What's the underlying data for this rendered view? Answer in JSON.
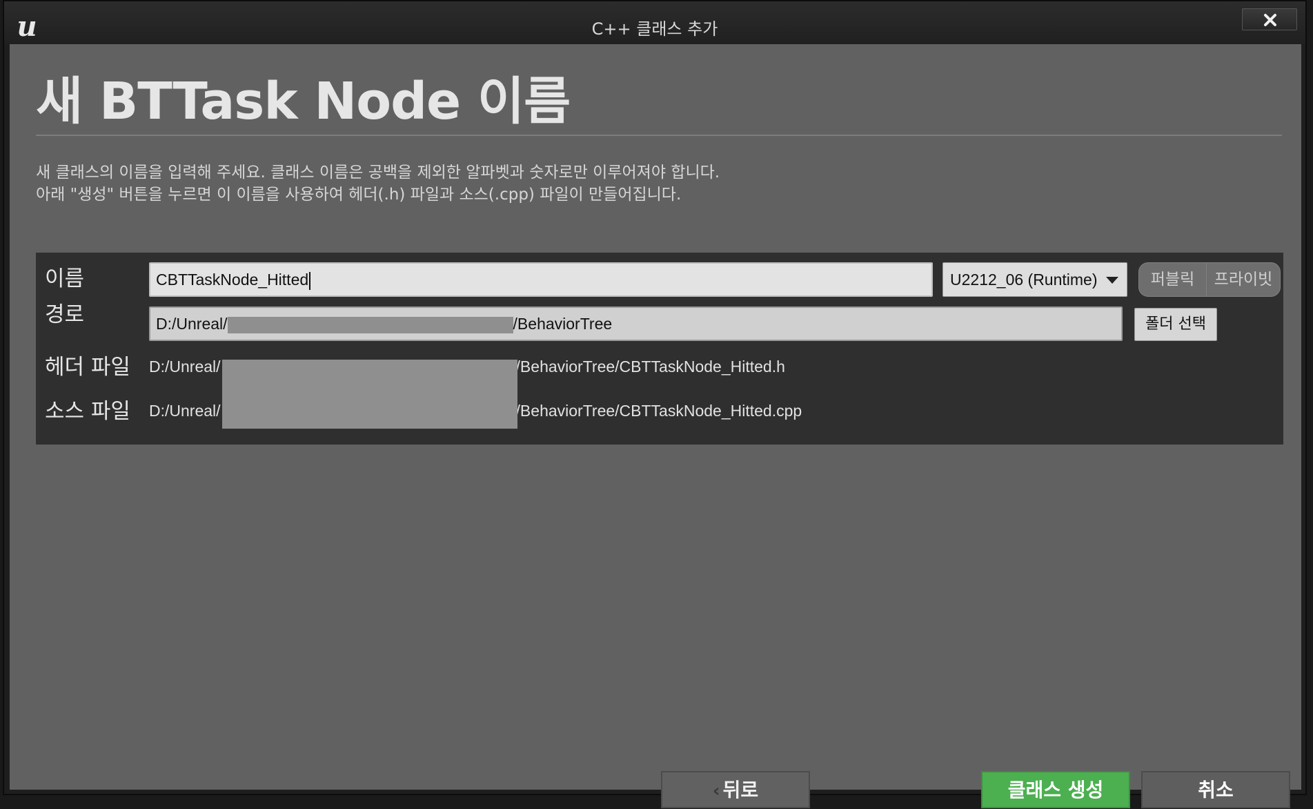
{
  "window": {
    "title": "C++ 클래스 추가",
    "logo_icon": "unreal-logo-icon",
    "logo_text": "u"
  },
  "heading": "새 BTTask Node 이름",
  "description": [
    "새 클래스의 이름을 입력해 주세요. 클래스 이름은 공백을 제외한 알파벳과 숫자로만 이루어져야 합니다.",
    "아래 \"생성\" 버튼을 누르면 이 이름을 사용하여 헤더(.h) 파일과 소스(.cpp) 파일이 만들어집니다."
  ],
  "form": {
    "name_label": "이름",
    "name_value": "CBTTaskNode_Hitted",
    "module_value": "U2212_06 (Runtime)",
    "public_label": "퍼블릭",
    "private_label": "프라이빗",
    "path_label": "경로",
    "path_prefix": "D:/Unreal/",
    "path_suffix": "/BehaviorTree",
    "folder_button": "폴더 선택",
    "header_label": "헤더 파일",
    "header_prefix": "D:/Unreal/",
    "header_suffix": "/BehaviorTree/CBTTaskNode_Hitted.h",
    "source_label": "소스 파일",
    "source_prefix": "D:/Unreal/",
    "source_suffix": "/BehaviorTree/CBTTaskNode_Hitted.cpp"
  },
  "buttons": {
    "back": "뒤로",
    "create": "클래스 생성",
    "cancel": "취소"
  },
  "colors": {
    "accent_create": "#4caf50",
    "panel": "#2f2f2f",
    "background": "#616161"
  }
}
